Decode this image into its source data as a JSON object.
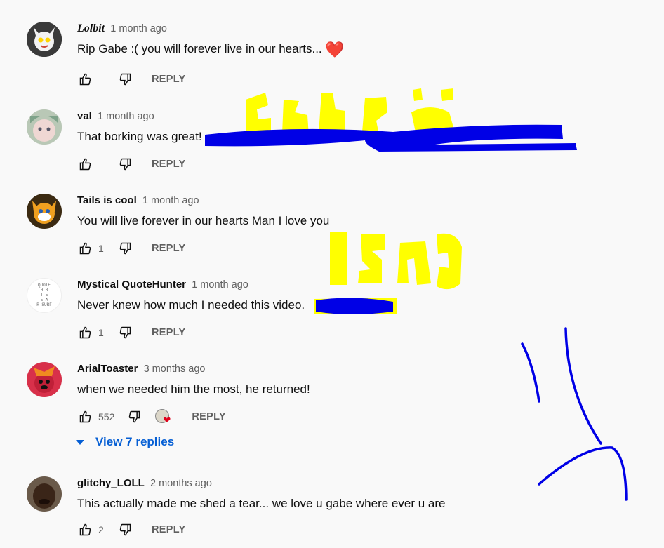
{
  "comments": [
    {
      "author": "Lolbit",
      "time": "1 month ago",
      "text": "Rip Gabe :( you will forever live in our hearts...",
      "emoji": "❤️",
      "likes": "",
      "reply_label": "REPLY"
    },
    {
      "author": "val",
      "time": "1 month ago",
      "text": "That borking was great!",
      "likes": "",
      "reply_label": "REPLY"
    },
    {
      "author": "Tails is cool",
      "time": "1 month ago",
      "text": "You will live forever in our hearts Man I love you",
      "likes": "1",
      "reply_label": "REPLY"
    },
    {
      "author": "Mystical QuoteHunter",
      "time": "1 month ago",
      "text": "Never knew how much I needed this video.",
      "likes": "1",
      "reply_label": "REPLY"
    },
    {
      "author": "ArialToaster",
      "time": "3 months ago",
      "text": "when we needed him the most, he returned!",
      "likes": "552",
      "reply_label": "REPLY"
    },
    {
      "author": "glitchy_LOLL",
      "time": "2 months ago",
      "text": "This actually made me shed a tear... we love u gabe where ever u are",
      "likes": "2",
      "reply_label": "REPLY"
    }
  ],
  "avatars": {
    "quotehunter_lines": [
      "QUOTE",
      "H R",
      "T E",
      "E A",
      "R SURF"
    ]
  },
  "view_replies": {
    "label": "View 7 replies"
  },
  "colors": {
    "background": "#f9f9f9",
    "link": "#065fd4",
    "scribble_blue": "#0000e6",
    "scribble_yellow": "#ffff00"
  }
}
